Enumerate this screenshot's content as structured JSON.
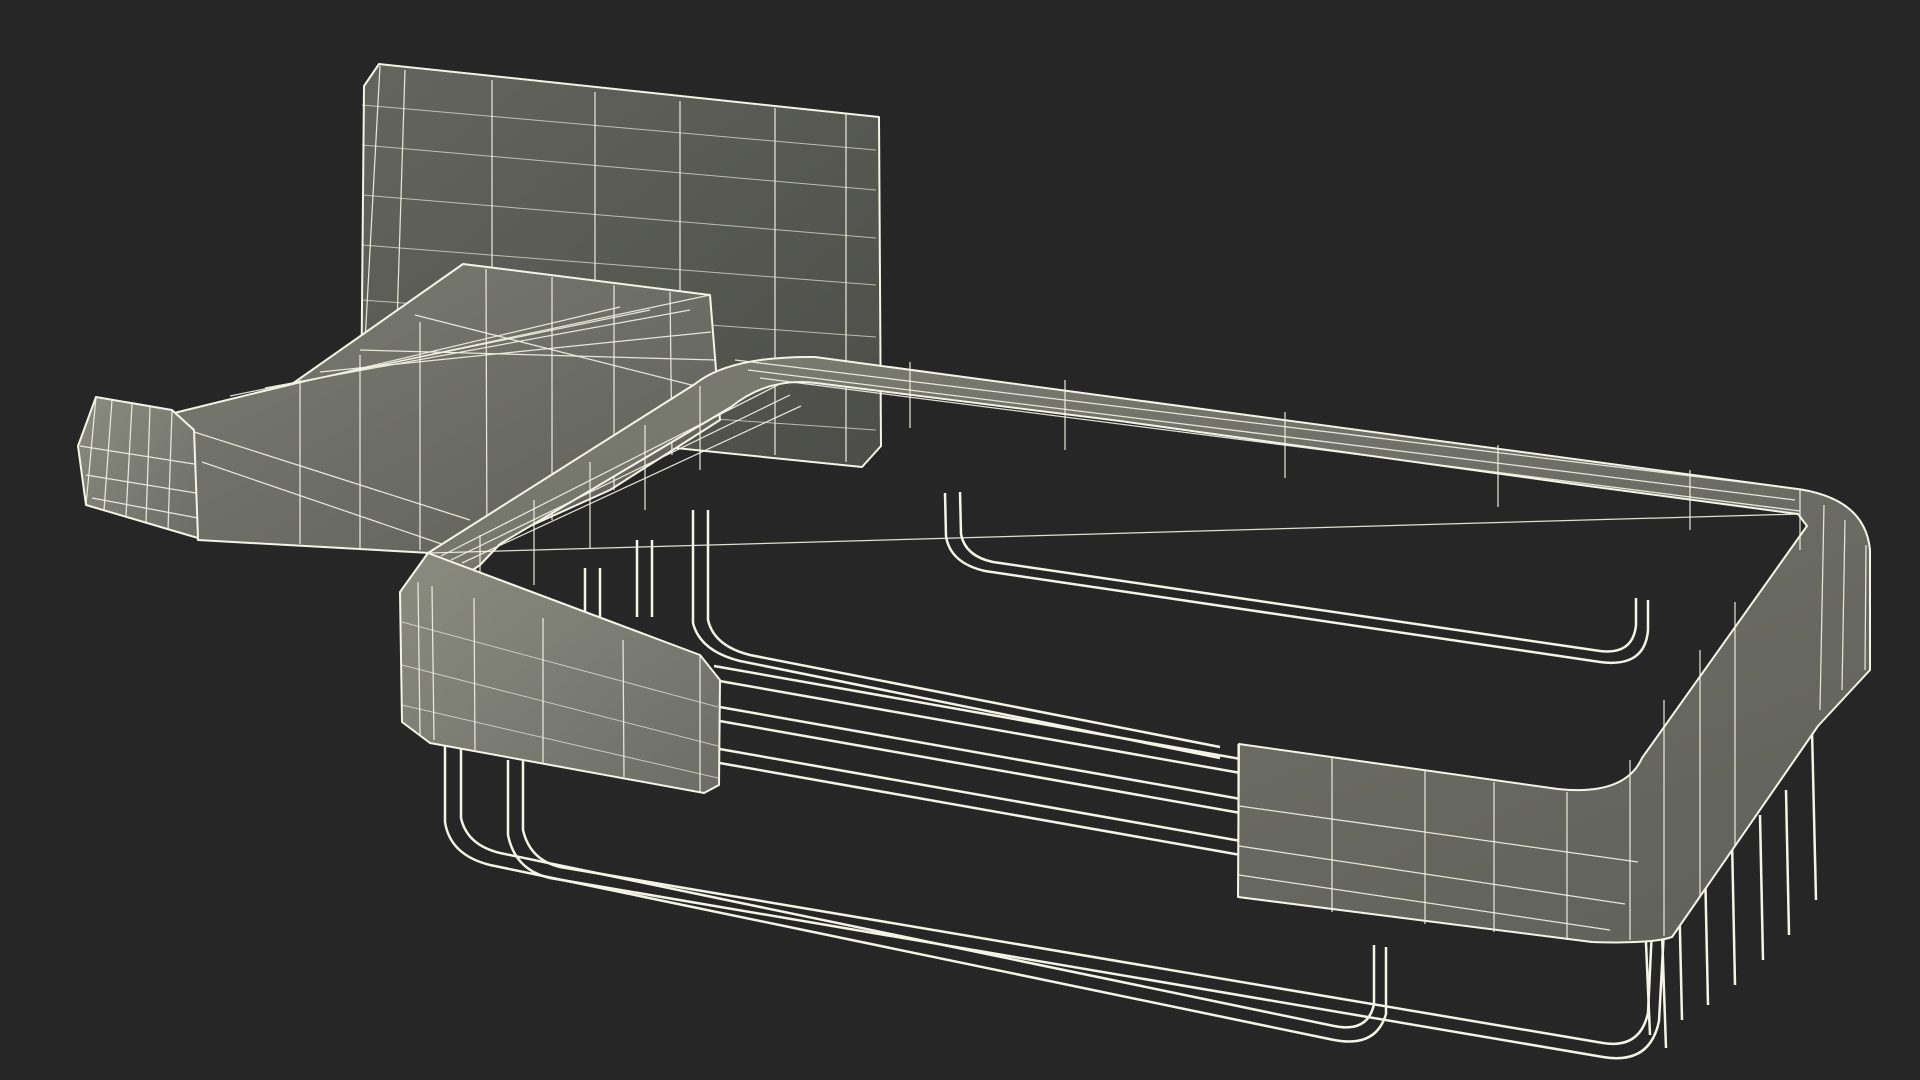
{
  "scene": {
    "background_color": "#262626",
    "mesh_fill_color": "#7a7b70",
    "mesh_shadow_color": "#5f605a",
    "wire_color": "#f4f4e6"
  }
}
